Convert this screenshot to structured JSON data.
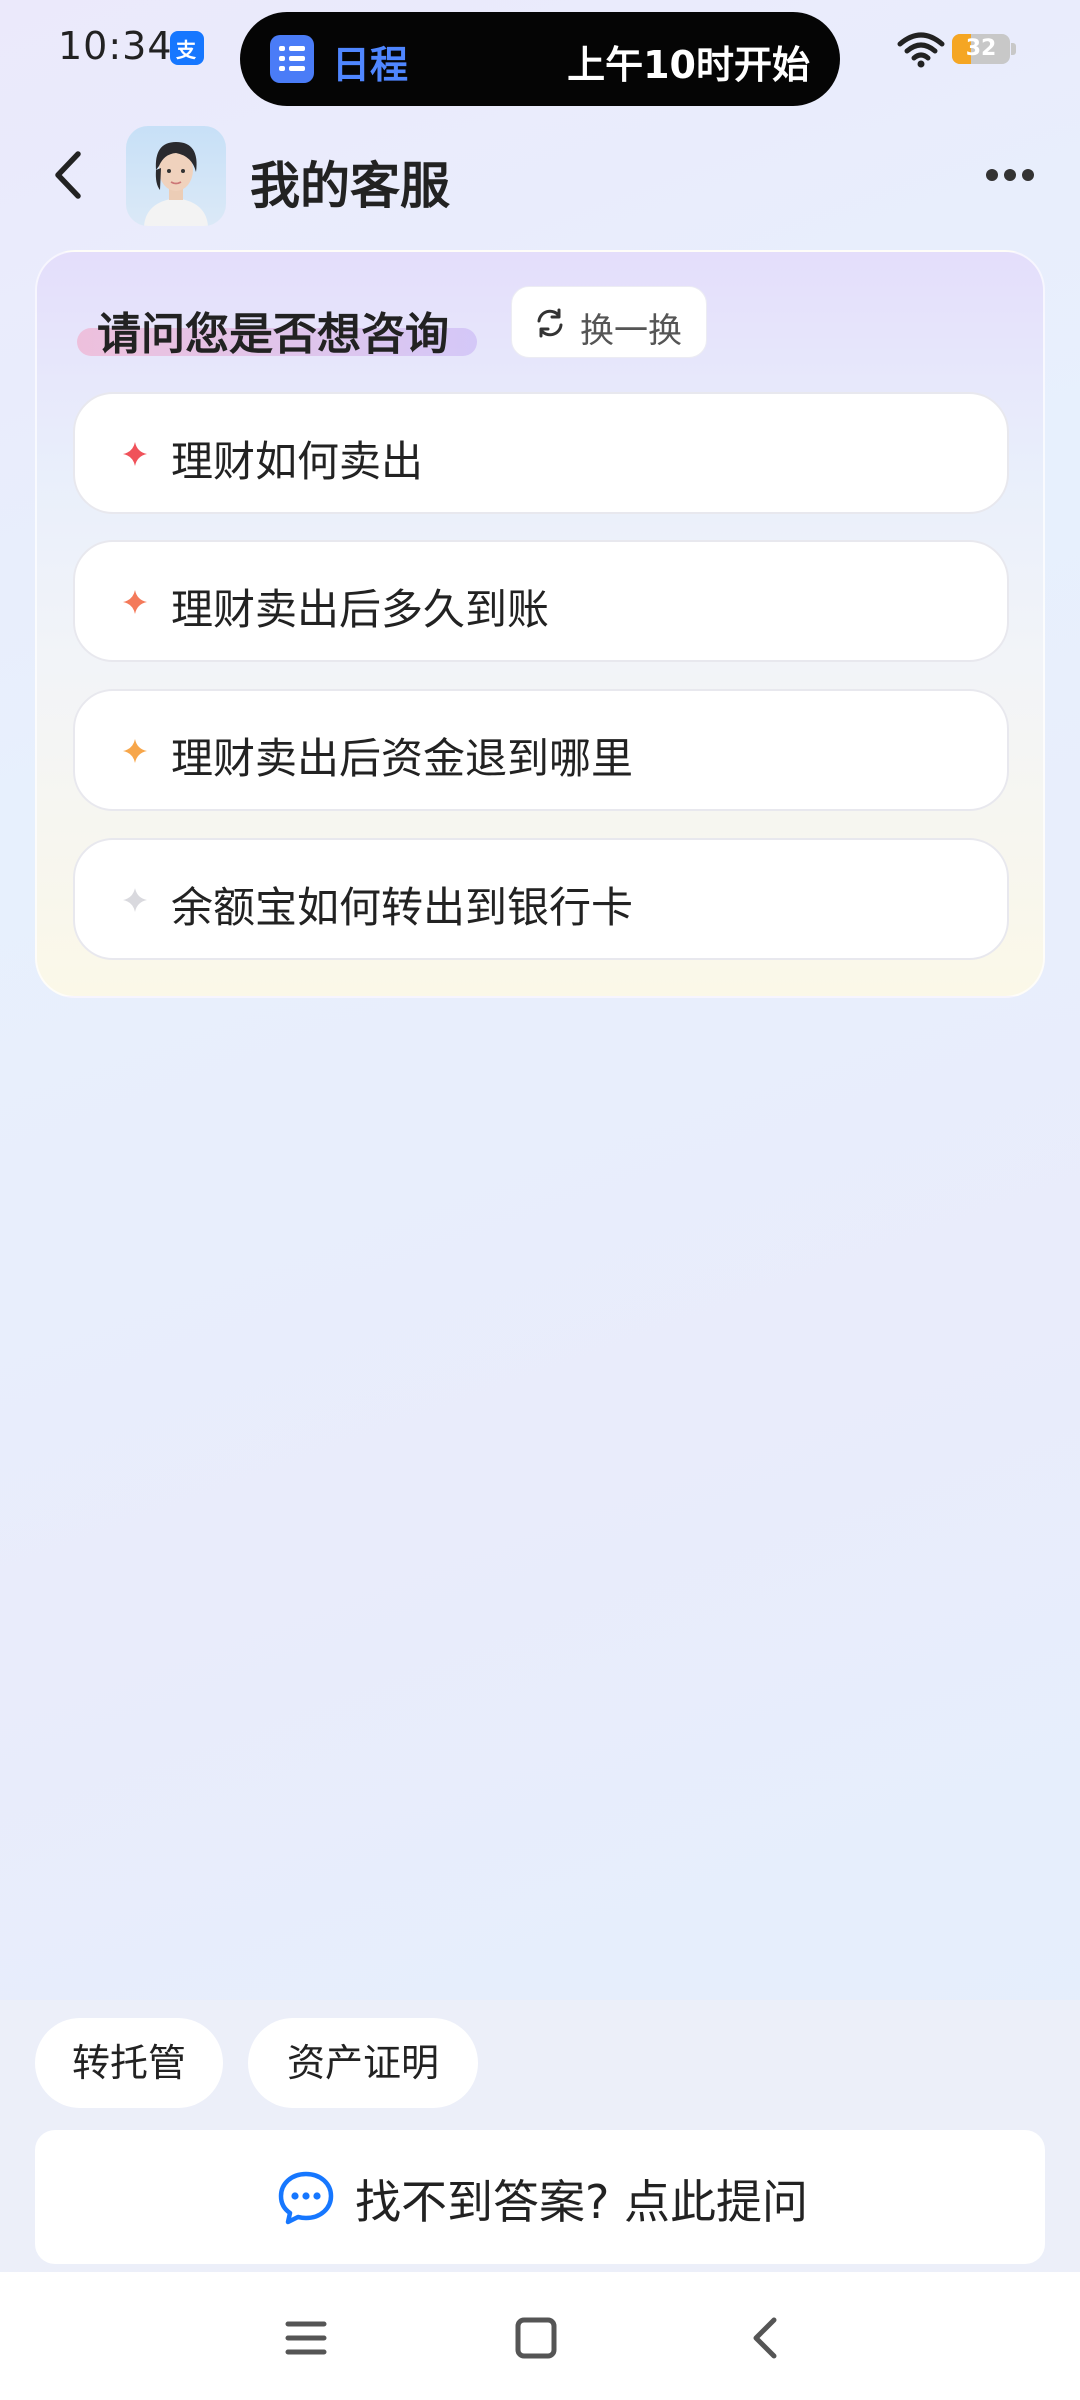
{
  "status_bar": {
    "time": "10:34",
    "notification_icon": "alipay-icon",
    "island": {
      "icon": "calendar-list-icon",
      "label": "日程",
      "text": "上午10时开始"
    },
    "wifi_icon": "wifi-icon",
    "battery_level": "32",
    "battery_fraction": 0.32,
    "battery_color": "#f5a623"
  },
  "header": {
    "back_icon": "chevron-left-icon",
    "title": "我的客服",
    "more_icon": "more-dots-icon"
  },
  "suggestions": {
    "title": "请问您是否想咨询",
    "refresh_label": "换一换",
    "items": [
      {
        "label": "理财如何卖出",
        "color": "#f0525a"
      },
      {
        "label": "理财卖出后多久到账",
        "color": "#f47a5a"
      },
      {
        "label": "理财卖出后资金退到哪里",
        "color": "#f7a64a"
      },
      {
        "label": "余额宝如何转出到银行卡",
        "color": "#d9d9de"
      }
    ]
  },
  "quick_actions": [
    {
      "label": "转托管"
    },
    {
      "label": "资产证明"
    }
  ],
  "ask_bar": {
    "icon": "chat-bubble-icon",
    "label": "找不到答案? 点此提问",
    "accent_color": "#1677ff"
  },
  "nav_bar": {
    "menu_icon": "menu-icon",
    "home_icon": "home-square-icon",
    "back_icon": "back-triangle-icon"
  }
}
